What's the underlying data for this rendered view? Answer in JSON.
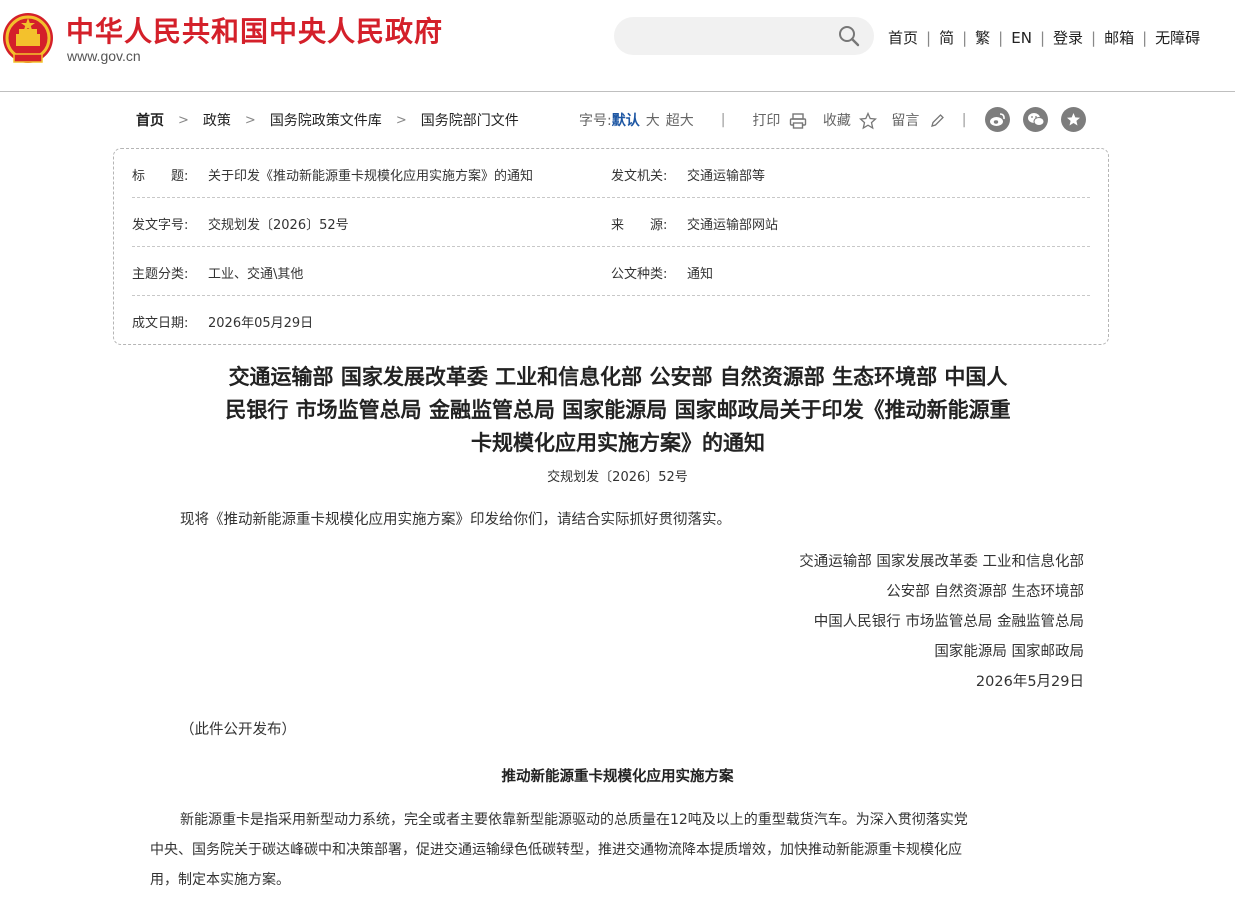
{
  "header": {
    "site_title": "中华人民共和国中央人民政府",
    "domain": "www.gov.cn",
    "search_placeholder": "",
    "nav": [
      "首页",
      "简",
      "繁",
      "EN",
      "登录",
      "邮箱",
      "无障碍"
    ],
    "brand_color": "#d4202a"
  },
  "breadcrumb": [
    "首页",
    "政策",
    "国务院政策文件库",
    "国务院部门文件"
  ],
  "toolbar": {
    "font_label": "字号:",
    "font_default": "默认",
    "font_large": "大",
    "font_xlarge": "超大",
    "print": "打印",
    "favorite": "收藏",
    "comment": "留言",
    "social_icons": [
      "weibo-icon",
      "wechat-icon",
      "star-icon"
    ]
  },
  "meta": {
    "title_label": "标　　题:",
    "title_value": "关于印发《推动新能源重卡规模化应用实施方案》的通知",
    "issuer_label": "发文机关:",
    "issuer_value": "交通运输部等",
    "docno_label": "发文字号:",
    "docno_value": "交规划发〔2026〕52号",
    "source_label": "来　　源:",
    "source_value": "交通运输部网站",
    "topic_label": "主题分类:",
    "topic_value": "工业、交通\\其他",
    "type_label": "公文种类:",
    "type_value": "通知",
    "date_label": "成文日期:",
    "date_value": "2026年05月29日"
  },
  "article": {
    "title_lines": [
      "交通运输部 国家发展改革委 工业和信息化部 公安部 自然资源部 生态环境部 中国人",
      "民银行 市场监管总局 金融监管总局 国家能源局 国家邮政局关于印发《推动新能源重",
      "卡规模化应用实施方案》的通知"
    ],
    "doc_no": "交规划发〔2026〕52号",
    "intro": "现将《推动新能源重卡规模化应用实施方案》印发给你们，请结合实际抓好贯彻落实。",
    "signatures": [
      "交通运输部 国家发展改革委 工业和信息化部",
      "公安部 自然资源部 生态环境部",
      "中国人民银行 市场监管总局 金融监管总局",
      "国家能源局 国家邮政局",
      "2026年5月29日"
    ],
    "public_note": "（此件公开发布）",
    "subtitle": "推动新能源重卡规模化应用实施方案",
    "body_lines": [
      "新能源重卡是指采用新型动力系统，完全或者主要依靠新型能源驱动的总质量在12吨及以上的重型载货汽车。为深入贯彻落实党",
      "中央、国务院关于碳达峰碳中和决策部署，促进交通运输绿色低碳转型，推进交通物流降本提质增效，加快推动新能源重卡规模化应",
      "用，制定本实施方案。"
    ]
  }
}
